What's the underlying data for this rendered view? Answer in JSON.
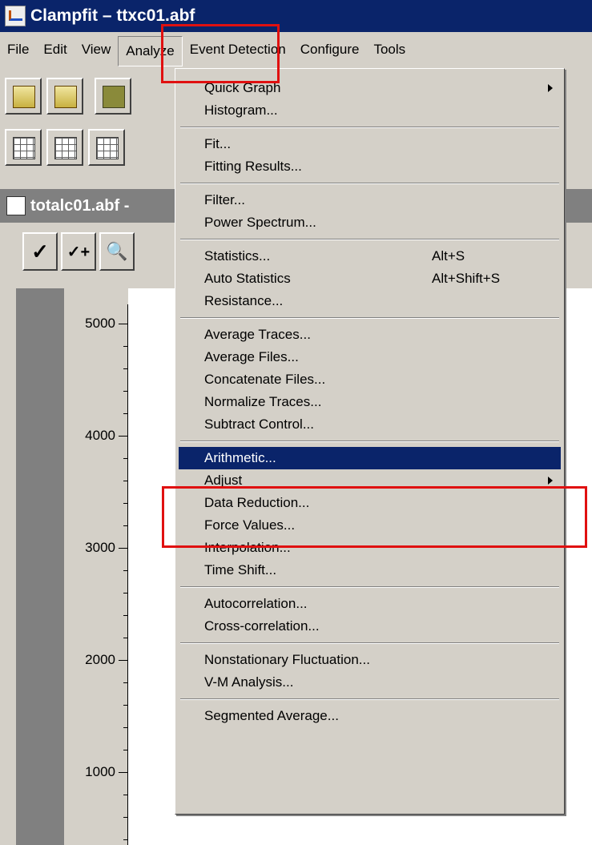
{
  "app": {
    "title": "Clampfit – ttxc01.abf"
  },
  "menubar": [
    "File",
    "Edit",
    "View",
    "Analyze",
    "Event Detection",
    "Configure",
    "Tools"
  ],
  "document": {
    "title": "totalc01.abf -"
  },
  "doc_toolbar": {
    "check": "✓",
    "check_plus": "✓+",
    "zoom": "🔍"
  },
  "plot": {
    "y_labels": [
      "5000",
      "4000",
      "3000",
      "2000",
      "1000"
    ]
  },
  "analyze_menu": {
    "items": [
      {
        "label": "Quick Graph",
        "submenu": true
      },
      {
        "label": "Histogram..."
      },
      {
        "sep": true
      },
      {
        "label": "Fit..."
      },
      {
        "label": "Fitting Results..."
      },
      {
        "sep": true
      },
      {
        "label": "Filter..."
      },
      {
        "label": "Power Spectrum..."
      },
      {
        "sep": true
      },
      {
        "label": "Statistics...",
        "shortcut": "Alt+S"
      },
      {
        "label": "Auto Statistics",
        "shortcut": "Alt+Shift+S"
      },
      {
        "label": "Resistance..."
      },
      {
        "sep": true
      },
      {
        "label": "Average Traces..."
      },
      {
        "label": "Average Files..."
      },
      {
        "label": "Concatenate Files..."
      },
      {
        "label": "Normalize Traces..."
      },
      {
        "label": "Subtract Control..."
      },
      {
        "sep": true
      },
      {
        "label": "Arithmetic...",
        "selected": true
      },
      {
        "label": "Adjust",
        "submenu": true
      },
      {
        "label": "Data Reduction..."
      },
      {
        "label": "Force Values..."
      },
      {
        "label": "Interpolation..."
      },
      {
        "label": "Time Shift..."
      },
      {
        "sep": true
      },
      {
        "label": "Autocorrelation..."
      },
      {
        "label": "Cross-correlation..."
      },
      {
        "sep": true
      },
      {
        "label": "Nonstationary Fluctuation..."
      },
      {
        "label": "V-M Analysis..."
      },
      {
        "sep": true
      },
      {
        "label": "Segmented Average..."
      }
    ]
  },
  "colors": {
    "title_bar": "#0a246a",
    "menu_bg": "#d4d0c8",
    "selection": "#0a246a",
    "highlight_box": "#e01010"
  }
}
